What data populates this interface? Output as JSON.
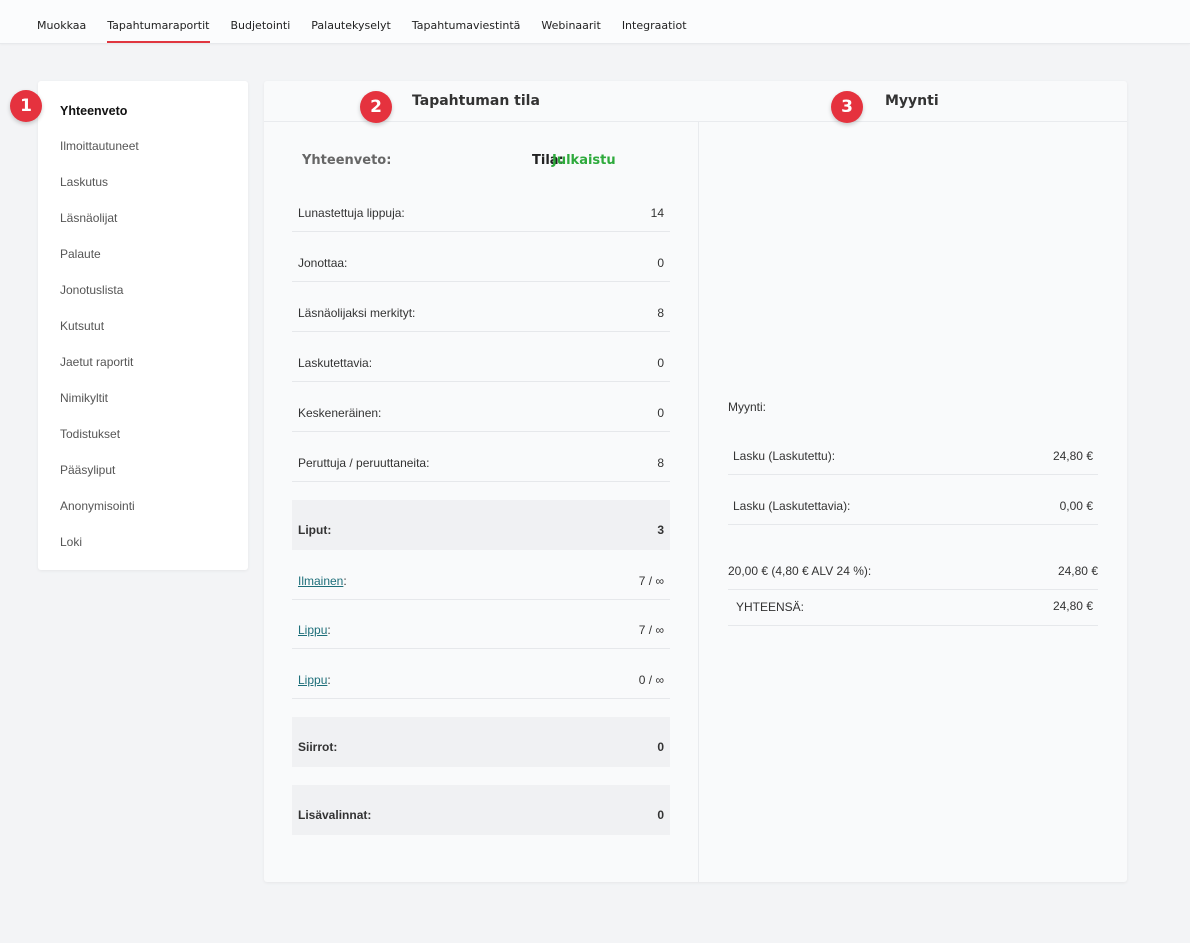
{
  "topnav": {
    "tabs": [
      "Muokkaa",
      "Tapahtumaraportit",
      "Budjetointi",
      "Palautekyselyt",
      "Tapahtumaviestintä",
      "Webinaarit",
      "Integraatiot"
    ],
    "active_index": 1
  },
  "sidebar": {
    "items": [
      "Yhteenveto",
      "Ilmoittautuneet",
      "Laskutus",
      "Läsnäolijat",
      "Palaute",
      "Jonotuslista",
      "Kutsutut",
      "Jaetut raportit",
      "Nimikyltit",
      "Todistukset",
      "Pääsyliput",
      "Anonymisointi",
      "Loki"
    ],
    "active_index": 0
  },
  "badges": [
    "1",
    "2",
    "3"
  ],
  "colors": {
    "accent": "#e5323e",
    "status_green": "#2eaa3c",
    "link": "#1e6f7a"
  },
  "status": {
    "header": "Tapahtuman tila",
    "summary_label": "Yhteenveto:",
    "tila_label": "Tila:",
    "tila_value": "Julkaistu",
    "rows": [
      {
        "label": "Lunastettuja lippuja:",
        "value": "14"
      },
      {
        "label": "Jonottaa:",
        "value": "0"
      },
      {
        "label": "Läsnäolijaksi merkityt:",
        "value": "8"
      },
      {
        "label": "Laskutettavia:",
        "value": "0"
      },
      {
        "label": "Keskeneräinen:",
        "value": "0"
      },
      {
        "label": "Peruttuja / peruuttaneita:",
        "value": "8"
      }
    ],
    "liput": {
      "label": "Liput:",
      "value": "3"
    },
    "tickets": [
      {
        "name": "Ilmainen",
        "value": "7 / ∞"
      },
      {
        "name": "Lippu",
        "value": "7 / ∞"
      },
      {
        "name": "Lippu",
        "value": "0 / ∞"
      }
    ],
    "siirrot": {
      "label": "Siirrot:",
      "value": "0"
    },
    "lisavalinnat": {
      "label": "Lisävalinnat:",
      "value": "0"
    }
  },
  "sales": {
    "header": "Myynti",
    "label": "Myynti:",
    "rows": [
      {
        "label": "Lasku (Laskutettu):",
        "value": "24,80 €"
      },
      {
        "label": "Lasku (Laskutettavia):",
        "value": "0,00 €"
      }
    ],
    "vat_row": {
      "label": "20,00 € (4,80 € ALV 24 %):",
      "value": "24,80 €"
    },
    "total": {
      "label": "YHTEENSÄ:",
      "value": "24,80 €"
    }
  }
}
